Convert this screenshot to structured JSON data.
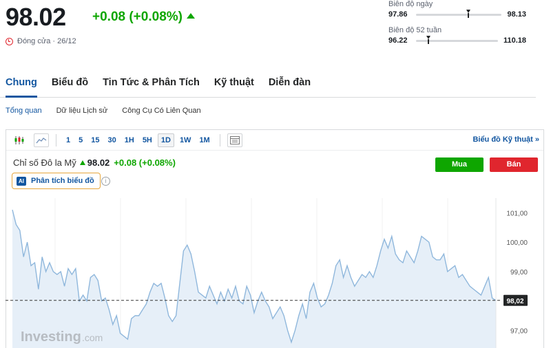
{
  "header": {
    "price": "98.02",
    "change": "+0.08 (+0.08%)",
    "close_label": "Đóng cửa · 26/12"
  },
  "day_range": {
    "label": "Biên độ ngày",
    "low": "97.86",
    "high": "98.13",
    "current_fraction": 0.59
  },
  "week52_range": {
    "label": "Biên độ 52 tuần",
    "low": "96.22",
    "high": "110.18",
    "current_fraction": 0.13
  },
  "tabs": [
    "Chung",
    "Biểu đồ",
    "Tin Tức & Phân Tích",
    "Kỹ thuật",
    "Diễn đàn"
  ],
  "subtabs": [
    "Tổng quan",
    "Dữ liệu Lịch sử",
    "Công Cụ Có Liên Quan"
  ],
  "toolbar": {
    "timeframes": [
      "1",
      "5",
      "15",
      "30",
      "1H",
      "5H",
      "1D",
      "1W",
      "1M"
    ],
    "active_timeframe": "1D",
    "tech_link": "Biểu đồ Kỹ thuật »"
  },
  "instrument": {
    "name": "Chỉ số Đô la Mỹ",
    "price": "98.02",
    "change": "+0.08 (+0.08%)"
  },
  "ai_button": {
    "badge": "AI",
    "label": "Phân tích biểu đồ"
  },
  "buy_label": "Mua",
  "sell_label": "Bán",
  "colors": {
    "up": "#0ea600",
    "down": "#e0262e",
    "accent": "#1256a0",
    "line": "#8fb7dc",
    "area": "#e6eff8"
  },
  "chart_data": {
    "type": "area",
    "y_ticks": [
      "101,00",
      "100,00",
      "99,00",
      "97,00"
    ],
    "y_tick_values": [
      101,
      100,
      99,
      97
    ],
    "ylim": [
      96.4,
      101.5
    ],
    "last_value": 98.02,
    "last_label": "98,02",
    "watermark": "Investing",
    "watermark_suffix": ".com",
    "values": [
      101.1,
      100.6,
      100.4,
      99.5,
      100.0,
      99.2,
      99.3,
      98.4,
      99.5,
      99.0,
      99.3,
      99.0,
      98.9,
      99.0,
      98.5,
      99.1,
      98.9,
      99.1,
      98.0,
      98.2,
      98.0,
      98.8,
      98.9,
      98.7,
      98.0,
      98.1,
      97.7,
      97.2,
      97.5,
      96.9,
      96.8,
      96.7,
      97.4,
      97.5,
      97.5,
      97.7,
      97.9,
      98.3,
      98.6,
      98.5,
      98.6,
      98.1,
      97.5,
      97.3,
      97.5,
      98.6,
      99.7,
      99.9,
      99.6,
      99.0,
      98.3,
      98.2,
      98.1,
      98.5,
      98.2,
      97.9,
      98.3,
      98.0,
      98.4,
      98.1,
      98.5,
      98.0,
      97.9,
      98.5,
      98.2,
      97.6,
      98.0,
      98.3,
      98.0,
      97.8,
      97.4,
      97.6,
      97.8,
      97.5,
      97.0,
      96.6,
      97.0,
      97.5,
      97.9,
      97.4,
      98.3,
      98.6,
      98.1,
      97.8,
      97.9,
      98.2,
      98.6,
      99.2,
      99.4,
      98.8,
      99.2,
      98.8,
      98.5,
      98.7,
      98.9,
      98.8,
      99.0,
      98.8,
      99.2,
      99.7,
      100.1,
      99.8,
      100.2,
      99.6,
      99.4,
      99.3,
      99.7,
      99.5,
      99.3,
      99.7,
      100.2,
      100.1,
      100.0,
      99.5,
      99.4,
      99.4,
      99.6,
      99.0,
      99.1,
      99.2,
      98.8,
      98.9,
      98.7,
      98.5,
      98.4,
      98.3,
      98.2,
      98.5,
      98.8,
      98.1,
      98.02
    ]
  }
}
